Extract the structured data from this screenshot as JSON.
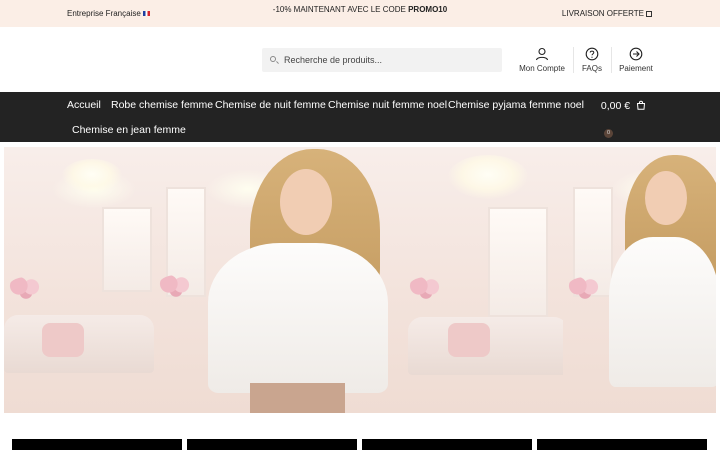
{
  "topbar": {
    "left_text": "Entreprise Française",
    "promo_prefix": "-10% MAINTENANT AVEC LE CODE ",
    "promo_code": "PROMO10",
    "shipping_text": "LIVRAISON OFFERTE"
  },
  "header": {
    "search_placeholder": "Recherche de produits...",
    "links": {
      "account": "Mon Compte",
      "faqs": "FAQs",
      "payment": "Paiement"
    }
  },
  "nav": {
    "items": [
      "Accueil",
      "Robe chemise femme",
      "Chemise de nuit femme",
      "Chemise nuit femme noel",
      "Chemise pyjama femme noel",
      "Chemise en jean femme"
    ],
    "cart_total": "0,00 €",
    "cart_count": "0"
  },
  "colors": {
    "topbar_bg": "#fbeee6",
    "nav_bg": "#232323",
    "badge_bg": "#5a4438"
  },
  "icons": {
    "account": "user-icon",
    "faqs": "help-circle-icon",
    "payment": "arrow-right-circle-icon",
    "cart": "shopping-bag-icon",
    "search": "search-icon",
    "flag": "france-flag-icon",
    "shipping": "truck-icon"
  }
}
